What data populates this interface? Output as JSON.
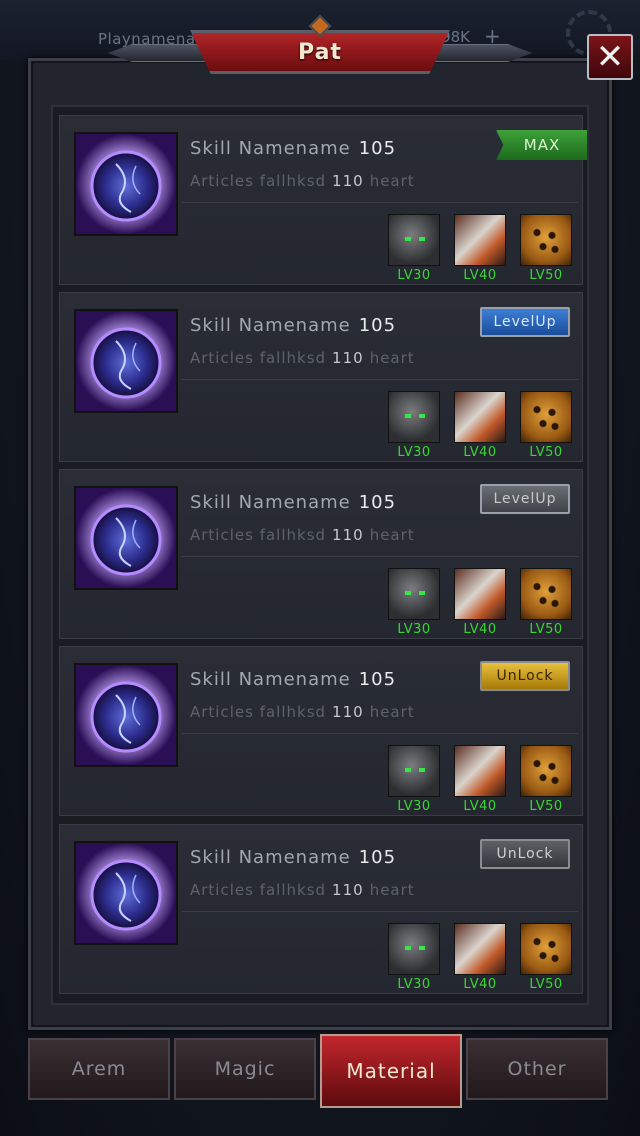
{
  "header": {
    "player_name": "Playnamename",
    "coins": "9098K",
    "plus": "+",
    "title": "Pat",
    "close_glyph": "✕"
  },
  "skills": [
    {
      "name": "Skill Namename",
      "level": "105",
      "desc_prefix": "Articles fallhksd",
      "desc_num": "110",
      "desc_suffix": "heart",
      "status": "MAX",
      "status_kind": "max",
      "pets": [
        {
          "kind": "wolf",
          "lv": "LV30"
        },
        {
          "kind": "fox",
          "lv": "LV40"
        },
        {
          "kind": "leopard",
          "lv": "LV50"
        }
      ]
    },
    {
      "name": "Skill Namename",
      "level": "105",
      "desc_prefix": "Articles fallhksd",
      "desc_num": "110",
      "desc_suffix": "heart",
      "status": "LevelUp",
      "status_kind": "levelup",
      "pets": [
        {
          "kind": "wolf",
          "lv": "LV30"
        },
        {
          "kind": "fox",
          "lv": "LV40"
        },
        {
          "kind": "leopard",
          "lv": "LV50"
        }
      ]
    },
    {
      "name": "Skill Namename",
      "level": "105",
      "desc_prefix": "Articles fallhksd",
      "desc_num": "110",
      "desc_suffix": "heart",
      "status": "LevelUp",
      "status_kind": "levelup-off",
      "pets": [
        {
          "kind": "wolf",
          "lv": "LV30"
        },
        {
          "kind": "fox",
          "lv": "LV40"
        },
        {
          "kind": "leopard",
          "lv": "LV50"
        }
      ]
    },
    {
      "name": "Skill Namename",
      "level": "105",
      "desc_prefix": "Articles fallhksd",
      "desc_num": "110",
      "desc_suffix": "heart",
      "status": "UnLock",
      "status_kind": "unlock",
      "pets": [
        {
          "kind": "wolf",
          "lv": "LV30"
        },
        {
          "kind": "fox",
          "lv": "LV40"
        },
        {
          "kind": "leopard",
          "lv": "LV50"
        }
      ]
    },
    {
      "name": "Skill Namename",
      "level": "105",
      "desc_prefix": "Articles fallhksd",
      "desc_num": "110",
      "desc_suffix": "heart",
      "status": "UnLock",
      "status_kind": "unlock-off",
      "pets": [
        {
          "kind": "wolf",
          "lv": "LV30"
        },
        {
          "kind": "fox",
          "lv": "LV40"
        },
        {
          "kind": "leopard",
          "lv": "LV50"
        }
      ]
    }
  ],
  "tabs": [
    {
      "label": "Arem",
      "active": false
    },
    {
      "label": "Magic",
      "active": false
    },
    {
      "label": "Material",
      "active": true
    },
    {
      "label": "Other",
      "active": false
    }
  ],
  "colors": {
    "level_green": "#39d733",
    "title_red": "#b02427",
    "max_green": "#3ea13a",
    "levelup_blue": "#3d7fd6",
    "unlock_gold": "#e8c13c"
  }
}
